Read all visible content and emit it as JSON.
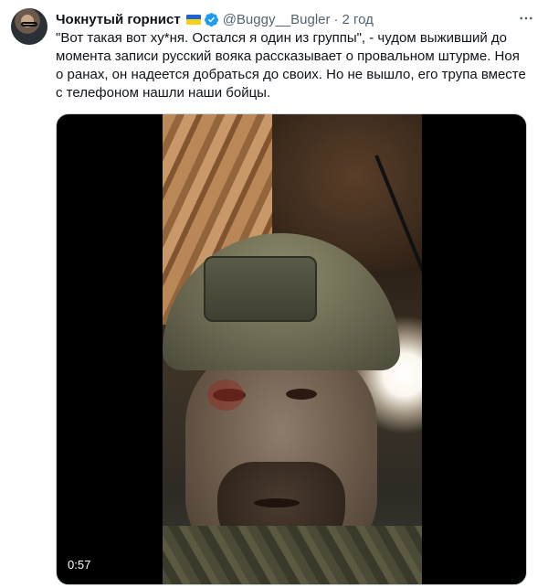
{
  "tweet": {
    "author_name": "Чокнутый горнист",
    "author_handle": "@Buggy__Bugler",
    "separator": "·",
    "time": "2 год",
    "text": "\"Вот такая вот ху*ня. Остался я один из группы\", - чудом выживший до\nмомента записи русский вояка рассказывает о провальном штурме. Ноя\nо ранах, он надеется добраться до своих. Но не вышло, его трупа вместе\nс телефоном нашли наши бойцы.",
    "flag_colors": {
      "top": "#1e62d6",
      "bottom": "#f7d117"
    },
    "verified_color": "#1d9bf0",
    "more_icon": "more-horizontal-icon"
  },
  "media": {
    "video_duration": "0:57"
  }
}
